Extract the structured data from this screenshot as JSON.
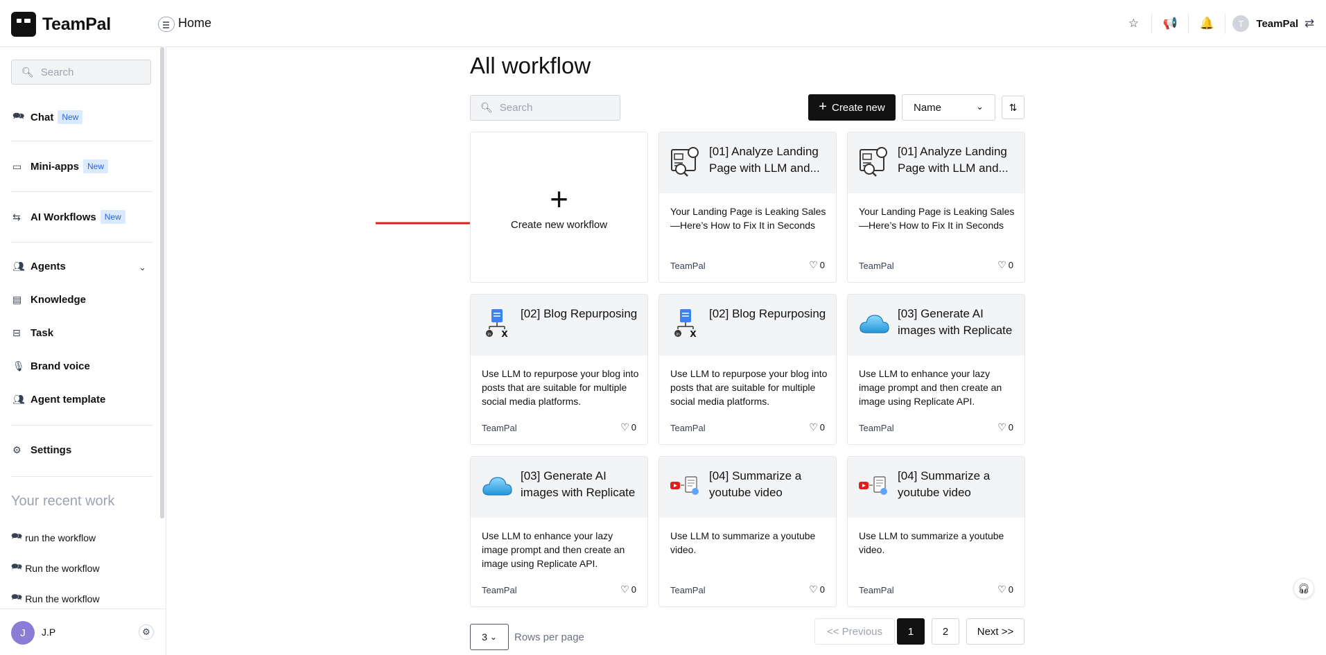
{
  "app": {
    "name": "TeamPal",
    "page": "Home",
    "user": "TeamPal",
    "user_initial": "T"
  },
  "sidebar": {
    "search_placeholder": "Search",
    "items": [
      {
        "label": "Chat",
        "badge": "New"
      },
      {
        "label": "Mini-apps",
        "badge": "New"
      },
      {
        "label": "AI Workflows",
        "badge": "New"
      },
      {
        "label": "Agents"
      },
      {
        "label": "Knowledge"
      },
      {
        "label": "Task"
      },
      {
        "label": "Brand voice"
      },
      {
        "label": "Agent template"
      },
      {
        "label": "Settings"
      }
    ],
    "recent_title": "Your recent work",
    "recent": [
      "run the workflow",
      "Run the workflow",
      "Run the workflow"
    ],
    "footer_user": "J.P",
    "footer_initial": "J"
  },
  "main": {
    "title": "All workflow",
    "search_placeholder": "Search",
    "create_label": "Create new",
    "sort_value": "Name",
    "new_card_label": "Create new workflow",
    "cards": [
      {
        "title": "[01] Analyze Landing Page with LLM and...",
        "desc": "Your Landing Page is Leaking Sales—Here’s How to Fix It in Seconds",
        "author": "TeamPal",
        "likes": "0",
        "icon": "analyze-icon"
      },
      {
        "title": "[01] Analyze Landing Page with LLM and...",
        "desc": "Your Landing Page is Leaking Sales—Here’s How to Fix It in Seconds",
        "author": "TeamPal",
        "likes": "0",
        "icon": "analyze-icon"
      },
      {
        "title": "[02] Blog Repurposing",
        "desc": "Use LLM to repurpose your blog into posts that are suitable for multiple social media platforms.",
        "author": "TeamPal",
        "likes": "0",
        "icon": "blog-icon"
      },
      {
        "title": "[02] Blog Repurposing",
        "desc": "Use LLM to repurpose your blog into posts that are suitable for multiple social media platforms.",
        "author": "TeamPal",
        "likes": "0",
        "icon": "blog-icon"
      },
      {
        "title": "[03] Generate AI images with Replicate",
        "desc": "Use LLM to enhance your lazy image prompt and then create an image using Replicate API.",
        "author": "TeamPal",
        "likes": "0",
        "icon": "cloud-icon"
      },
      {
        "title": "[03] Generate AI images with Replicate",
        "desc": "Use LLM to enhance your lazy image prompt and then create an image using Replicate API.",
        "author": "TeamPal",
        "likes": "0",
        "icon": "cloud-icon"
      },
      {
        "title": "[04] Summarize a youtube video",
        "desc": "Use LLM to summarize a youtube video.",
        "author": "TeamPal",
        "likes": "0",
        "icon": "youtube-icon"
      },
      {
        "title": "[04] Summarize a youtube video",
        "desc": "Use LLM to summarize a youtube video.",
        "author": "TeamPal",
        "likes": "0",
        "icon": "youtube-icon"
      }
    ]
  },
  "pagination": {
    "rows_value": "3",
    "rows_label": "Rows per page",
    "prev_label": "<< Previous",
    "pages": [
      "1",
      "2"
    ],
    "current": "1",
    "next_label": "Next >>"
  },
  "colors": {
    "accent": "#111111",
    "badge_bg": "#dbeafe",
    "badge_text": "#2563eb",
    "arrow": "#e11d1d"
  }
}
